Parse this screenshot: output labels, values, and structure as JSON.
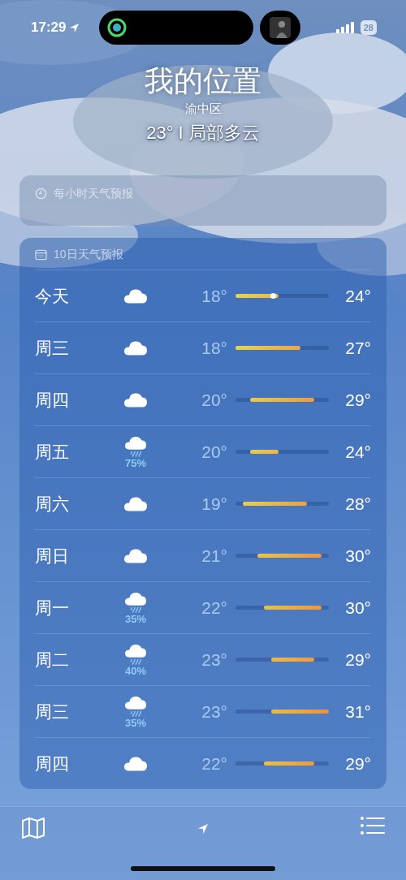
{
  "status_bar": {
    "time": "17:29",
    "battery": "28"
  },
  "header": {
    "title": "我的位置",
    "district": "渝中区",
    "summary": "23° I 局部多云"
  },
  "hourly": {
    "title": "每小时天气预报"
  },
  "daily": {
    "title": "10日天气预报",
    "days": [
      {
        "day": "今天",
        "kind": "cloud",
        "low": "18°",
        "high": "24°",
        "now": {
          "level": 0.4
        }
      },
      {
        "day": "周三",
        "kind": "cloud",
        "low": "18°",
        "high": "27°"
      },
      {
        "day": "周四",
        "kind": "cloud",
        "low": "20°",
        "high": "29°"
      },
      {
        "day": "周五",
        "kind": "rain",
        "chance": "75%",
        "low": "20°",
        "high": "24°"
      },
      {
        "day": "周六",
        "kind": "cloud",
        "low": "19°",
        "high": "28°"
      },
      {
        "day": "周日",
        "kind": "cloud",
        "low": "21°",
        "high": "30°"
      },
      {
        "day": "周一",
        "kind": "rain",
        "chance": "35%",
        "low": "22°",
        "high": "30°"
      },
      {
        "day": "周二",
        "kind": "rain",
        "chance": "40%",
        "low": "23°",
        "high": "29°"
      },
      {
        "day": "周三",
        "kind": "rain",
        "chance": "35%",
        "low": "23°",
        "high": "31°"
      },
      {
        "day": "周四",
        "kind": "cloud",
        "low": "22°",
        "high": "29°"
      }
    ]
  }
}
